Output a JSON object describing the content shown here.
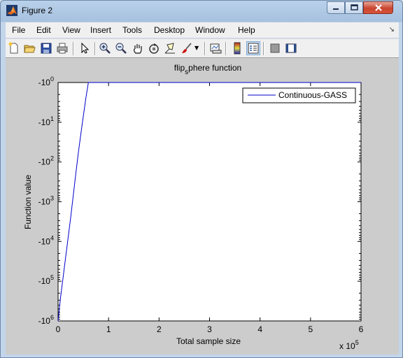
{
  "window": {
    "title": "Figure 2"
  },
  "menu": {
    "items": [
      "File",
      "Edit",
      "View",
      "Insert",
      "Tools",
      "Desktop",
      "Window",
      "Help"
    ]
  },
  "toolbar": {
    "buttons": [
      "new-figure-icon",
      "open-file-icon",
      "save-figure-icon",
      "print-figure-icon",
      "edit-plot-icon",
      "zoom-in-icon",
      "zoom-out-icon",
      "pan-icon",
      "rotate-3d-icon",
      "data-cursor-icon",
      "brush-icon",
      "link-plot-icon",
      "colorbar-icon",
      "legend-icon",
      "hide-plot-tools-icon",
      "show-plot-tools-icon"
    ]
  },
  "plot": {
    "title_main": "flip",
    "title_sub": "s",
    "title_rest": "phere function"
  },
  "chart_data": {
    "type": "line",
    "title": "flip_sphere function",
    "xlabel": "Total sample size",
    "ylabel": "Function value",
    "x_multiplier": "x 10",
    "x_multiplier_exp": "5",
    "xlim": [
      0,
      6
    ],
    "ylim": [
      -1000000,
      -1
    ],
    "y_scale": "log-negative",
    "x_ticks": [
      "0",
      "1",
      "2",
      "3",
      "4",
      "5",
      "6"
    ],
    "y_ticks": [
      {
        "base": "-10",
        "exp": "0"
      },
      {
        "base": "-10",
        "exp": "1"
      },
      {
        "base": "-10",
        "exp": "2"
      },
      {
        "base": "-10",
        "exp": "3"
      },
      {
        "base": "-10",
        "exp": "4"
      },
      {
        "base": "-10",
        "exp": "5"
      },
      {
        "base": "-10",
        "exp": "6"
      }
    ],
    "legend_position": "top-right",
    "grid": false,
    "series": [
      {
        "name": "Continuous-GASS",
        "color": "#0000cc",
        "x": [
          0,
          0.05,
          0.1,
          0.15,
          0.2,
          0.25,
          0.3,
          0.35,
          0.4,
          0.45,
          0.5,
          0.55,
          0.6,
          0.7,
          1,
          2,
          3,
          4,
          5,
          6
        ],
        "y": [
          -1000000,
          -250000,
          -80000,
          -25000,
          -8000,
          -2500,
          -700,
          -200,
          -60,
          -20,
          -7,
          -2.5,
          -1,
          -1,
          -1,
          -1,
          -1,
          -1,
          -1,
          -1
        ]
      }
    ]
  }
}
